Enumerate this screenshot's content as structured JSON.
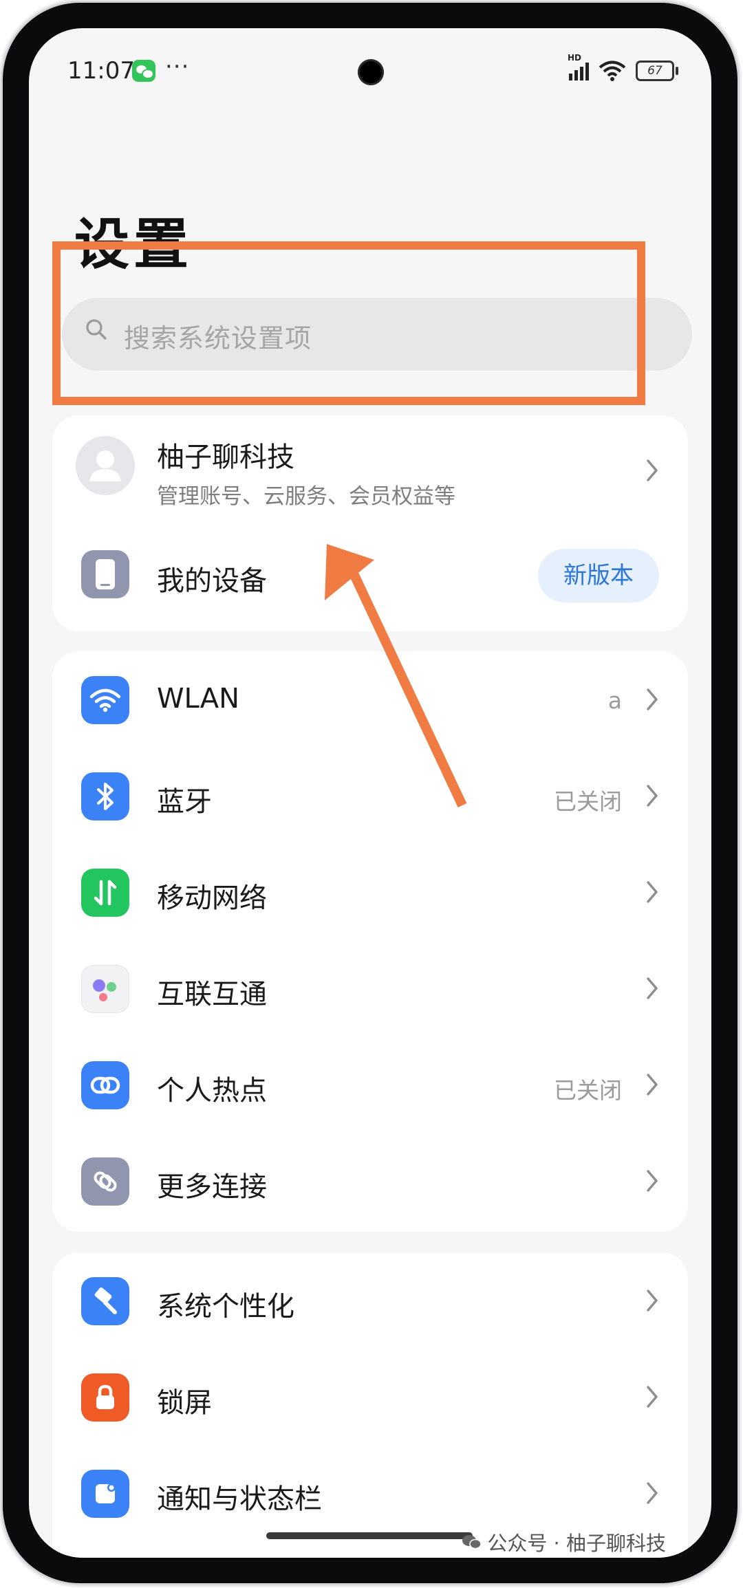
{
  "status_bar": {
    "time": "11:07",
    "dots": "···",
    "network": "HD",
    "battery": "67"
  },
  "page": {
    "title": "设置"
  },
  "search": {
    "placeholder": "搜索系统设置项"
  },
  "account": {
    "name": "柚子聊科技",
    "subtitle": "管理账号、云服务、会员权益等"
  },
  "device": {
    "label": "我的设备",
    "badge": "新版本"
  },
  "connectivity": [
    {
      "label": "WLAN",
      "value": "a",
      "icon": "wifi-icon",
      "color": "#3b82f6"
    },
    {
      "label": "蓝牙",
      "value": "已关闭",
      "icon": "bluetooth-icon",
      "color": "#3b82f6"
    },
    {
      "label": "移动网络",
      "value": "",
      "icon": "mobile-network-icon",
      "color": "#22c55e"
    },
    {
      "label": "互联互通",
      "value": "",
      "icon": "interconnect-icon",
      "color": "#f2f2f4"
    },
    {
      "label": "个人热点",
      "value": "已关闭",
      "icon": "hotspot-icon",
      "color": "#3b82f6"
    },
    {
      "label": "更多连接",
      "value": "",
      "icon": "more-connections-icon",
      "color": "#8f96ad"
    }
  ],
  "personalization": [
    {
      "label": "系统个性化",
      "icon": "personalization-icon",
      "color": "#3b82f6"
    },
    {
      "label": "锁屏",
      "icon": "lock-icon",
      "color": "#f05a24"
    },
    {
      "label": "通知与状态栏",
      "icon": "notification-icon",
      "color": "#3b82f6"
    }
  ],
  "watermark": {
    "text": "公众号 · 柚子聊科技"
  }
}
